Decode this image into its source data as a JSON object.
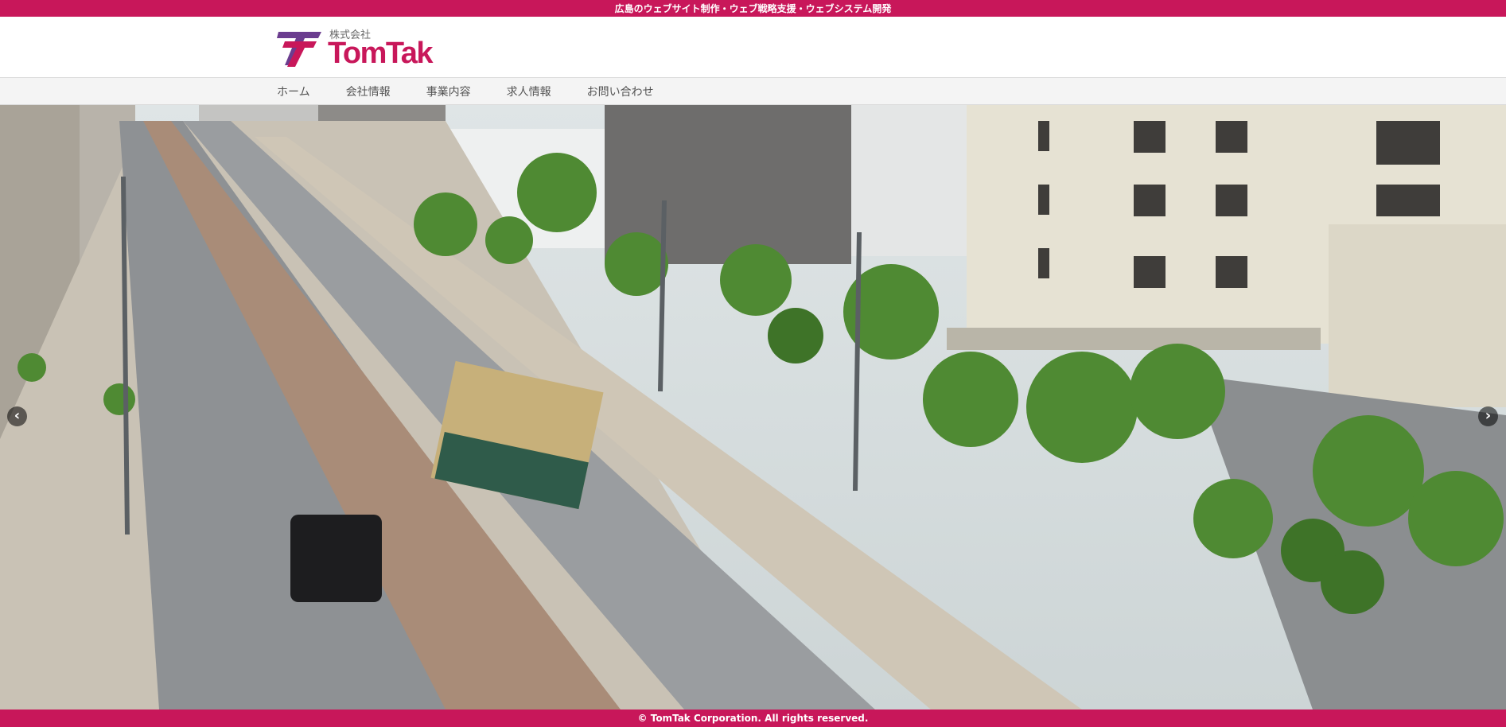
{
  "topbar": {
    "tagline": "広島のウェブサイト制作・ウェブ戦略支援・ウェブシステム開発"
  },
  "logo": {
    "kaisha": "株式会社",
    "name": "TomTak"
  },
  "nav": {
    "items": [
      "ホーム",
      "会社情報",
      "事業内容",
      "求人情報",
      "お問い合わせ"
    ]
  },
  "hero": {
    "prev_icon": "arrow-left-icon",
    "next_icon": "arrow-right-icon"
  },
  "footer": {
    "copyright": "© TomTak Corporation. All rights reserved."
  },
  "colors": {
    "brand": "#c8175a",
    "logo_purple": "#6b3d8f",
    "nav_bg": "#f4f4f4"
  }
}
